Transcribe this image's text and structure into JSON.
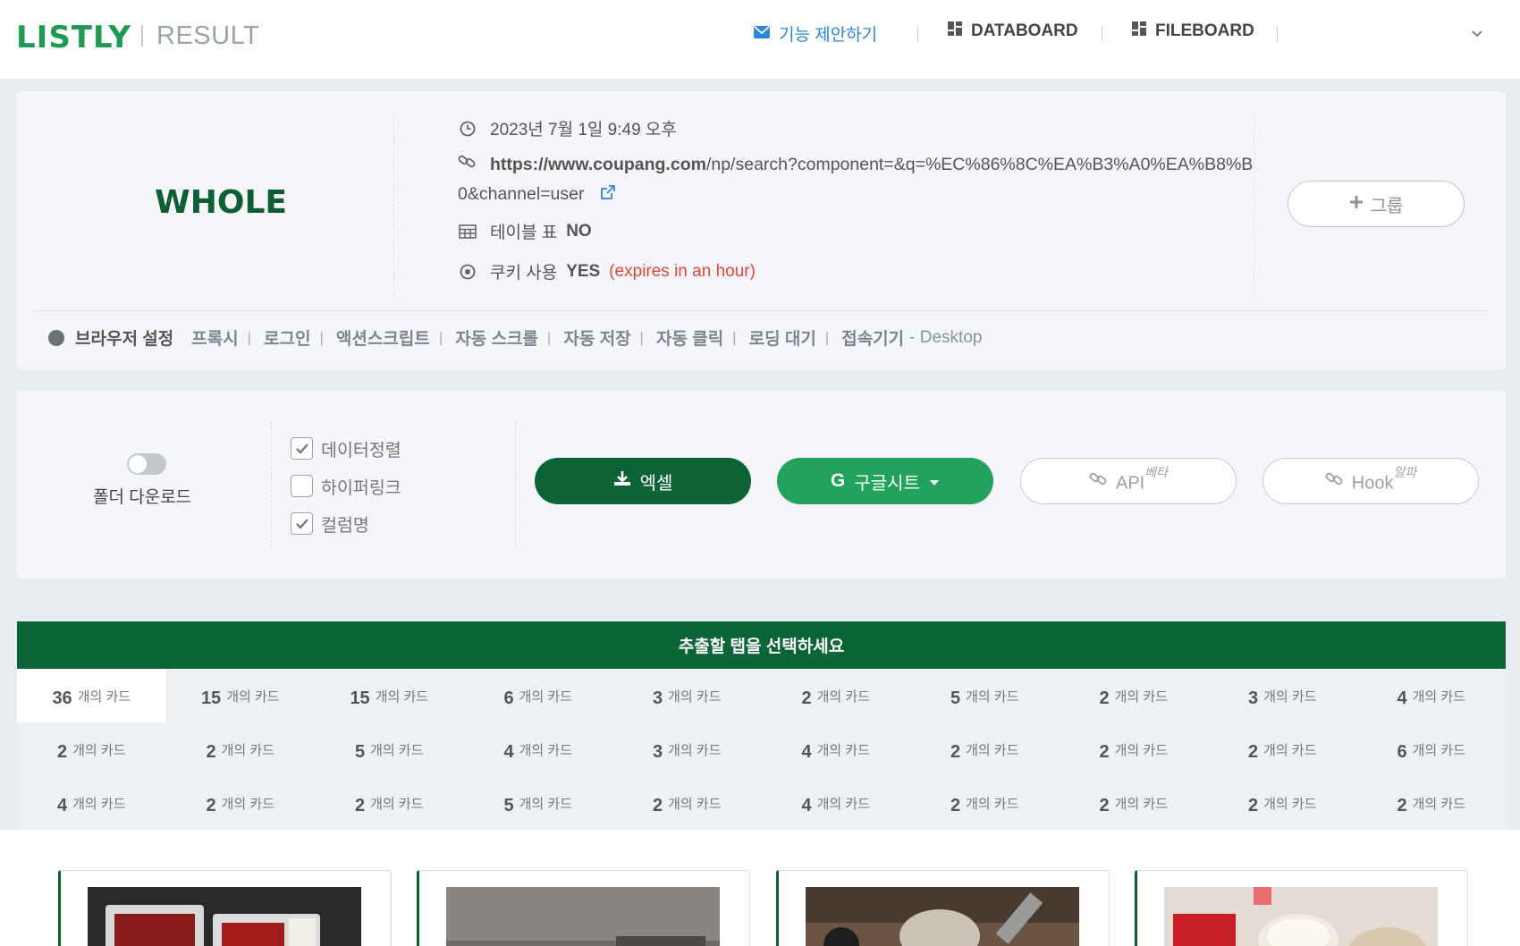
{
  "header": {
    "logo": "LISTLY",
    "logo_sub": "RESULT",
    "nav": {
      "suggest": "기능 제안하기",
      "databoard": "DATABOARD",
      "fileboard": "FILEBOARD"
    }
  },
  "info": {
    "title": "WHOLE",
    "datetime": "2023년 7월 1일 9:49 오후",
    "url_host": "https://www.coupang.com",
    "url_path": "/np/search?component=&q=%EC%86%8C%EA%B3%A0%EA%B8%B0&channel=user",
    "table_label": "테이블 표",
    "table_value": "NO",
    "cookie_label": "쿠키 사용",
    "cookie_value": "YES",
    "cookie_expires": "(expires in an hour)",
    "group_button": "그룹",
    "browser_settings": "브라우저 설정",
    "options": [
      "프록시",
      "로그인",
      "액션스크립트",
      "자동 스크롤",
      "자동 저장",
      "자동 클릭",
      "로딩 대기",
      "접속기기"
    ],
    "device": "- Desktop"
  },
  "download": {
    "folder_download": "폴더 다운로드",
    "checkboxes": [
      {
        "label": "데이터정렬",
        "checked": true
      },
      {
        "label": "하이퍼링크",
        "checked": false
      },
      {
        "label": "컬럼명",
        "checked": true
      }
    ],
    "excel": "엑셀",
    "gsheet": "구글시트",
    "api": "API",
    "api_sup": "베타",
    "hook": "Hook",
    "hook_sup": "알파"
  },
  "tabs": {
    "heading": "추출할 탭을 선택하세요",
    "unit": "개의 카드",
    "counts": [
      36,
      15,
      15,
      6,
      3,
      2,
      5,
      2,
      3,
      4,
      2,
      2,
      5,
      4,
      3,
      4,
      2,
      2,
      2,
      6,
      4,
      2,
      2,
      5,
      2,
      4,
      2,
      2,
      2,
      2
    ],
    "active_index": 0
  },
  "colors": {
    "brand": "#1f9a52",
    "dark_green": "#0d6236",
    "green": "#22a35c",
    "link_blue": "#2a87d8",
    "warning_red": "#e0453b"
  }
}
